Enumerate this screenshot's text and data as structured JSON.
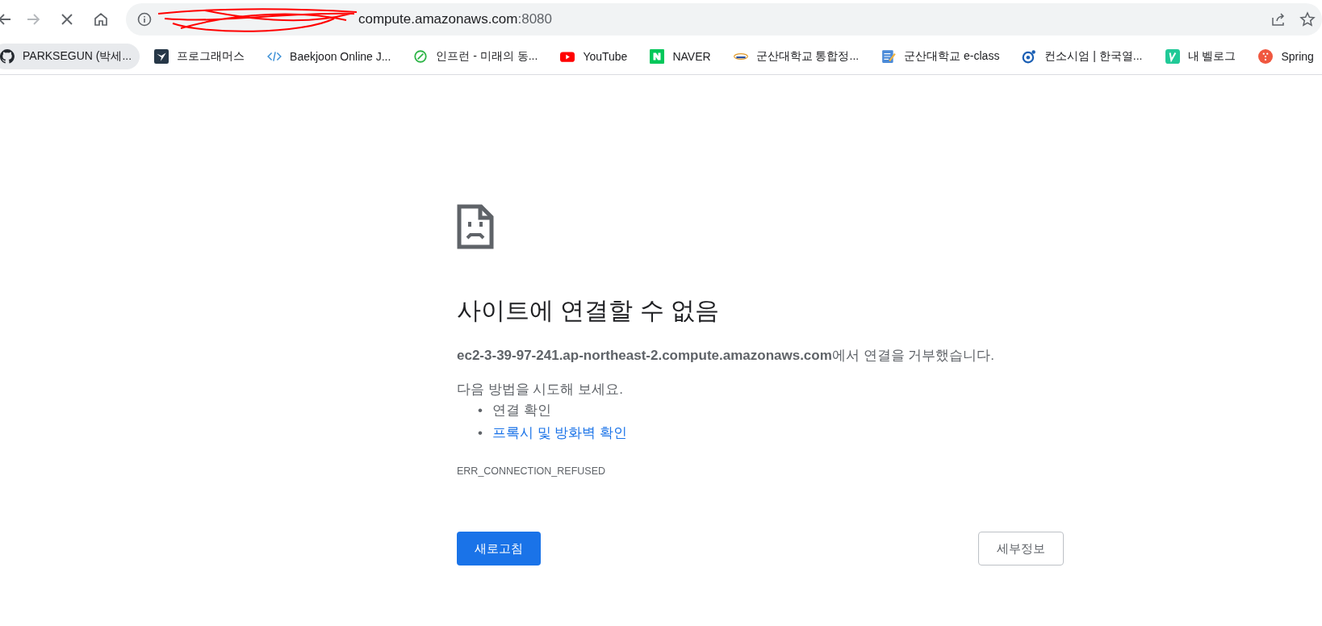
{
  "address_bar": {
    "url_visible": "compute.amazonaws.com",
    "url_port": ":8080"
  },
  "bookmarks": [
    {
      "label": "PARKSEGUN (박세...",
      "kind": "github",
      "highlighted": true
    },
    {
      "label": "프로그래머스",
      "kind": "bird",
      "highlighted": false
    },
    {
      "label": "Baekjoon Online J...",
      "kind": "code",
      "highlighted": false
    },
    {
      "label": "인프런 - 미래의 동...",
      "kind": "leaf",
      "highlighted": false
    },
    {
      "label": "YouTube",
      "kind": "youtube",
      "highlighted": false
    },
    {
      "label": "NAVER",
      "kind": "naver",
      "highlighted": false
    },
    {
      "label": "군산대학교 통합정...",
      "kind": "ksnu",
      "highlighted": false
    },
    {
      "label": "군산대학교 e-class",
      "kind": "notepad",
      "highlighted": false
    },
    {
      "label": "컨소시엄 | 한국열...",
      "kind": "target",
      "highlighted": false
    },
    {
      "label": "내 벨로그",
      "kind": "velog",
      "highlighted": false
    },
    {
      "label": "Spring",
      "kind": "spring",
      "highlighted": false
    }
  ],
  "error": {
    "title": "사이트에 연결할 수 없음",
    "host": "ec2-3-39-97-241.ap-northeast-2.compute.amazonaws.com",
    "message": "에서 연결을 거부했습니다.",
    "suggestions_intro": "다음 방법을 시도해 보세요.",
    "suggestions": [
      {
        "bullet": "•",
        "text": "연결 확인",
        "kind": "text"
      },
      {
        "bullet": "•",
        "text": "프록시 및 방화벽 확인",
        "kind": "link"
      }
    ],
    "code": "ERR_CONNECTION_REFUSED"
  },
  "buttons": {
    "reload": "새로고침",
    "details": "세부정보"
  }
}
